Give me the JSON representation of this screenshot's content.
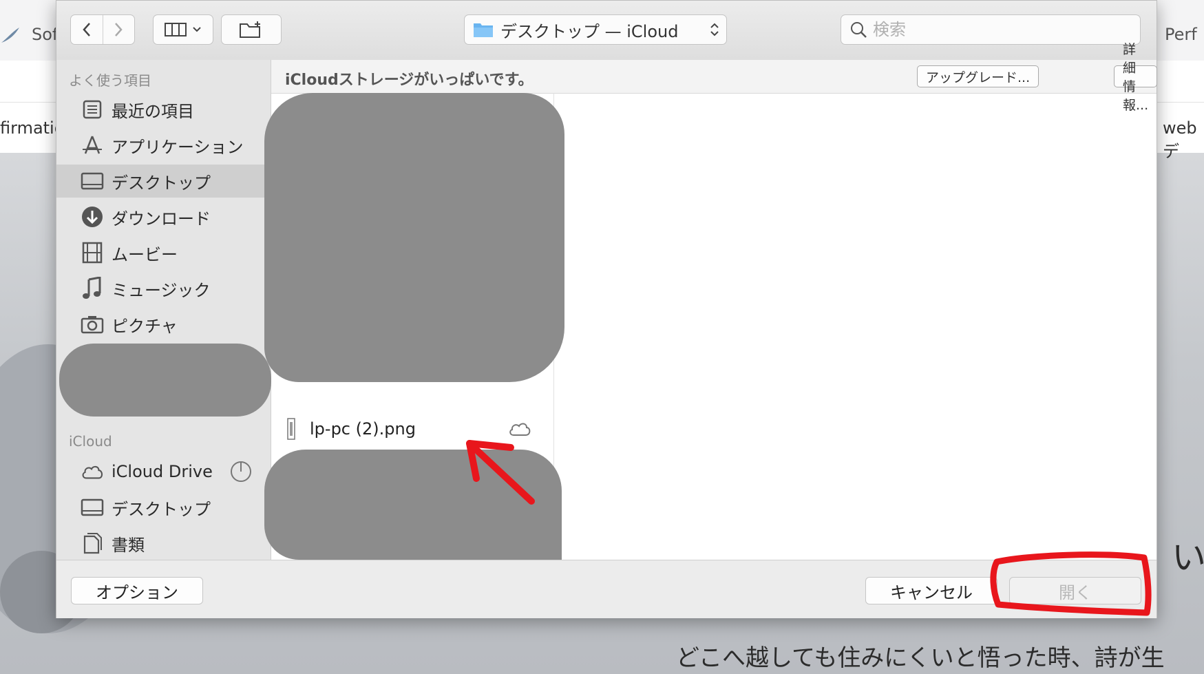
{
  "background": {
    "tab_left": "Sof",
    "tab_right": "Perf",
    "row_left": "firmatio",
    "row_right": "webデ",
    "headline_fragment": "い",
    "poem": "どこへ越しても住みにくいと悟った時、詩が生"
  },
  "toolbar": {
    "back_icon": "chevron-left-icon",
    "forward_icon": "chevron-right-icon",
    "view_icon": "column-view-icon",
    "new_folder_icon": "new-folder-icon",
    "path_label": "デスクトップ — iCloud",
    "search_placeholder": "検索"
  },
  "sidebar": {
    "favorites_heading": "よく使う項目",
    "favorites": [
      {
        "label": "最近の項目",
        "icon": "recents-icon"
      },
      {
        "label": "アプリケーション",
        "icon": "applications-icon"
      },
      {
        "label": "デスクトップ",
        "icon": "desktop-icon",
        "selected": true
      },
      {
        "label": "ダウンロード",
        "icon": "download-icon"
      },
      {
        "label": "ムービー",
        "icon": "movie-icon"
      },
      {
        "label": "ミュージック",
        "icon": "music-icon"
      },
      {
        "label": "ピクチャ",
        "icon": "camera-icon"
      }
    ],
    "icloud_heading": "iCloud",
    "icloud": [
      {
        "label": "iCloud Drive",
        "icon": "cloud-icon"
      },
      {
        "label": "デスクトップ",
        "icon": "desktop-icon"
      },
      {
        "label": "書類",
        "icon": "documents-icon"
      }
    ]
  },
  "banner": {
    "message": "iCloudストレージがいっぱいです。",
    "upgrade_label": "アップグレード...",
    "details_label": "詳細情報..."
  },
  "file": {
    "name": "lp-pc (2).png",
    "status_icon": "cloud-icon"
  },
  "footer": {
    "options_label": "オプション",
    "cancel_label": "キャンセル",
    "open_label": "開く"
  },
  "colors": {
    "annotation_red": "#e8161c",
    "selection_gray": "#cfcfcf",
    "redaction_gray": "#8c8c8c"
  }
}
